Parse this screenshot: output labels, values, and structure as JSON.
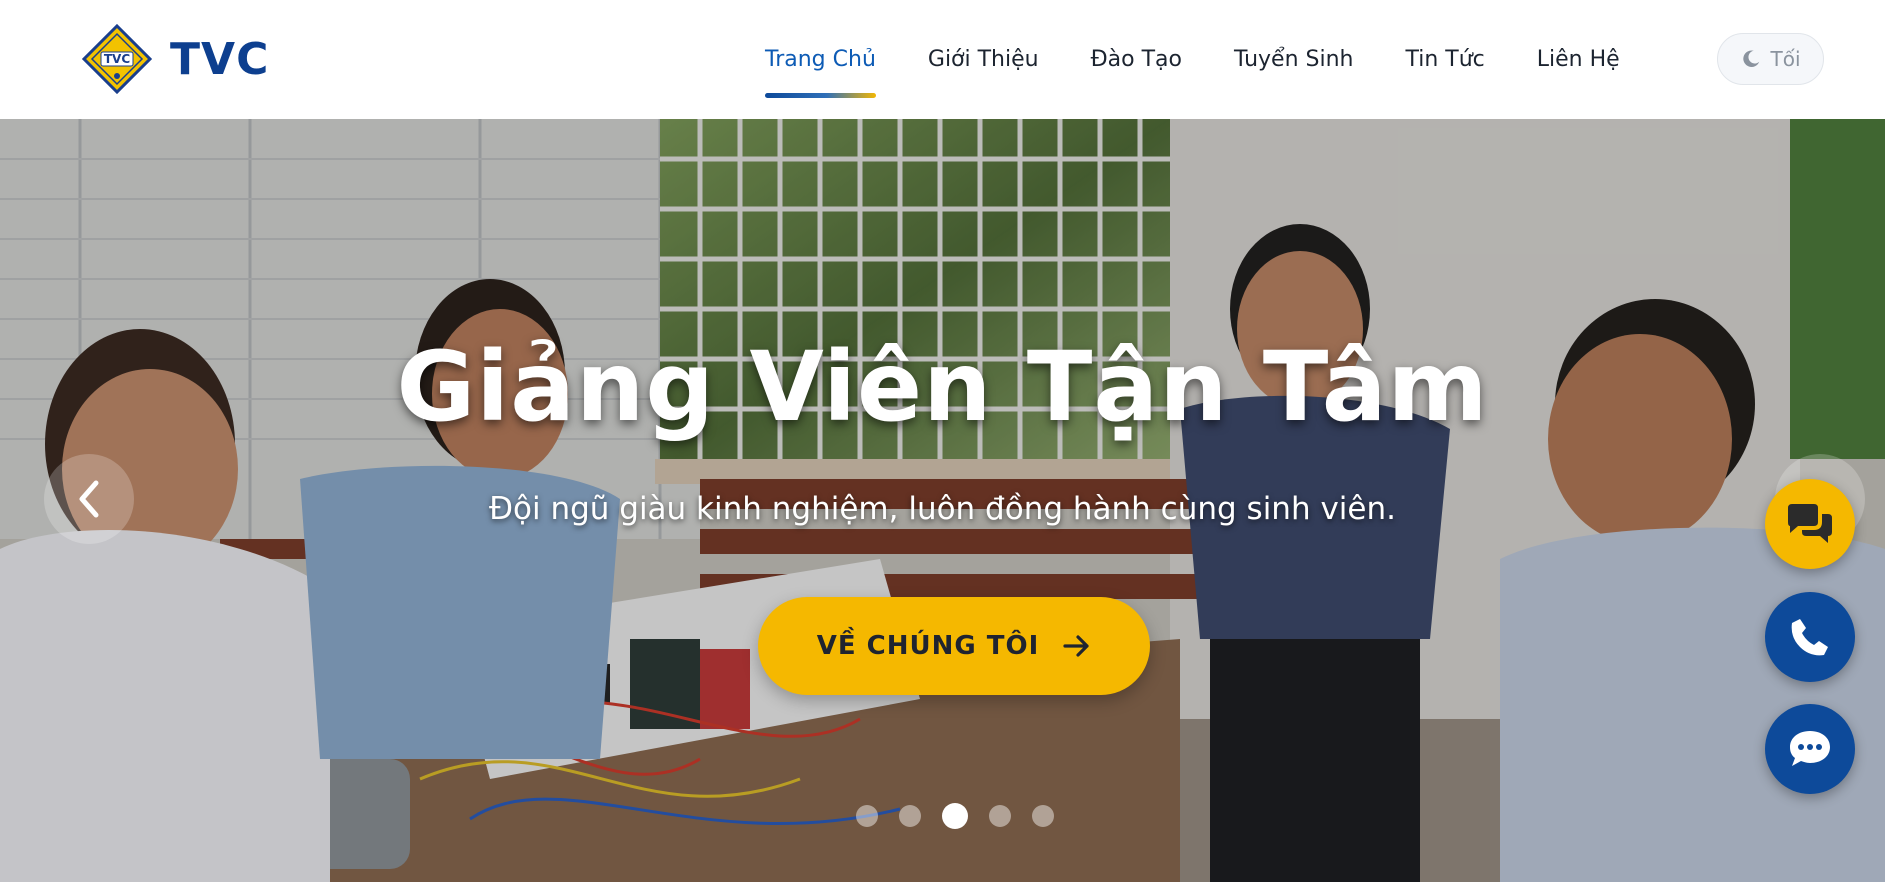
{
  "brand": {
    "name": "TVC",
    "badge_text": "TVC"
  },
  "nav": {
    "items": [
      {
        "label": "Trang Chủ",
        "active": true
      },
      {
        "label": "Giới Thiệu",
        "active": false
      },
      {
        "label": "Đào Tạo",
        "active": false
      },
      {
        "label": "Tuyển Sinh",
        "active": false
      },
      {
        "label": "Tin Tức",
        "active": false
      },
      {
        "label": "Liên Hệ",
        "active": false
      }
    ]
  },
  "theme_toggle": {
    "label": "Tối",
    "icon": "moon-icon"
  },
  "hero": {
    "title": "Giảng Viên Tận Tâm",
    "subtitle": "Đội ngũ giàu kinh nghiệm, luôn đồng hành cùng sinh viên.",
    "cta_label": "VỀ CHÚNG TÔI",
    "slides_count": 5,
    "active_slide": 3
  },
  "floating_buttons": [
    {
      "name": "chat-bubbles-icon",
      "color": "#f5b800"
    },
    {
      "name": "phone-icon",
      "color": "#0d4a9a"
    },
    {
      "name": "message-icon",
      "color": "#0d4a9a"
    }
  ],
  "colors": {
    "brand_blue": "#0d3f8f",
    "accent_yellow": "#f5b800",
    "nav_active": "#0d5bb5"
  }
}
